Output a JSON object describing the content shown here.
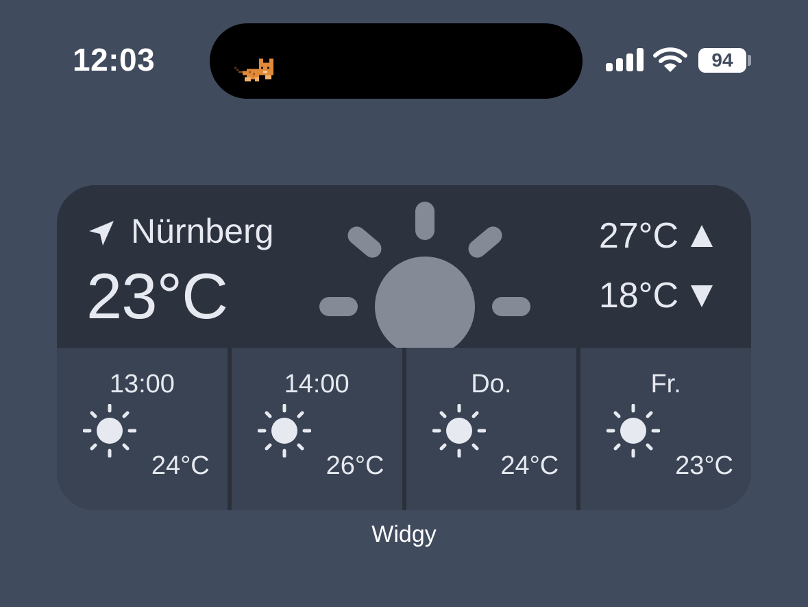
{
  "status_bar": {
    "time": "12:03",
    "battery_level": "94",
    "signal_icon": "cellular-signal-icon",
    "wifi_icon": "wifi-icon",
    "island_icon": "pixel-cat-icon"
  },
  "widget": {
    "location_icon": "location-arrow-icon",
    "city": "Nürnberg",
    "current_temp": "23°C",
    "condition_icon": "sun-icon",
    "high_temp": "27°C",
    "low_temp": "18°C",
    "forecast": [
      {
        "label": "13:00",
        "icon": "sun-icon",
        "temp": "24°C"
      },
      {
        "label": "14:00",
        "icon": "sun-icon",
        "temp": "26°C"
      },
      {
        "label": "Do.",
        "icon": "sun-icon",
        "temp": "24°C"
      },
      {
        "label": "Fr.",
        "icon": "sun-icon",
        "temp": "23°C"
      }
    ]
  },
  "app_name": "Widgy",
  "colors": {
    "background": "#414b5e",
    "widget_top": "#2c323e",
    "forecast_cell": "#3a4353",
    "sun_large": "#858b96",
    "sun_small": "#e6e9f0"
  }
}
